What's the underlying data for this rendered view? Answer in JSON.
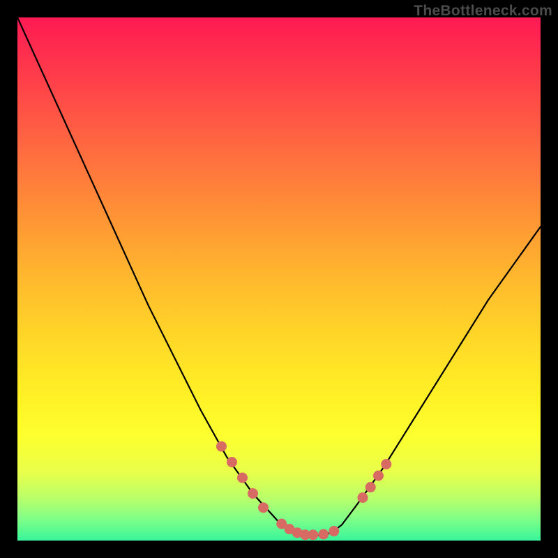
{
  "watermark": "TheBottleneck.com",
  "chart_data": {
    "type": "line",
    "title": "",
    "xlabel": "",
    "ylabel": "",
    "xlim": [
      0,
      100
    ],
    "ylim": [
      0,
      100
    ],
    "series": [
      {
        "name": "curve",
        "x": [
          0,
          5,
          10,
          15,
          20,
          25,
          30,
          35,
          40,
          45,
          50,
          52,
          55,
          58,
          60,
          62,
          65,
          70,
          75,
          80,
          85,
          90,
          95,
          100
        ],
        "values": [
          100,
          89,
          78,
          67,
          56,
          45,
          35,
          25,
          16,
          9,
          3.5,
          2,
          1,
          1,
          1.5,
          3,
          7,
          14,
          22,
          30,
          38,
          46,
          53,
          60
        ]
      }
    ],
    "markers": {
      "name": "highlight-dots",
      "color": "#d86a64",
      "radius": 7.5,
      "x": [
        39,
        41,
        43,
        45,
        47,
        50.5,
        52,
        53.5,
        55,
        56.5,
        58.5,
        60.5,
        66,
        67.5,
        69,
        70.5
      ],
      "values": [
        18,
        15,
        12,
        9,
        6.3,
        3.2,
        2.2,
        1.5,
        1.1,
        1.1,
        1.2,
        1.8,
        8.2,
        10.2,
        12.4,
        14.6
      ]
    }
  }
}
